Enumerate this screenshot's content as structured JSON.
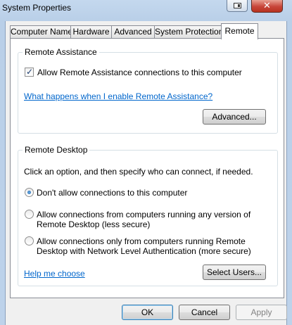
{
  "window": {
    "title": "System Properties",
    "close_label": "✕"
  },
  "tabs": [
    {
      "label": "Computer Name"
    },
    {
      "label": "Hardware"
    },
    {
      "label": "Advanced"
    },
    {
      "label": "System Protection"
    },
    {
      "label": "Remote",
      "active": true
    }
  ],
  "remote_assistance": {
    "group_title": "Remote Assistance",
    "allow_checkbox_label": "Allow Remote Assistance connections to this computer",
    "allow_checked": true,
    "help_link": "What happens when I enable Remote Assistance?",
    "advanced_button": "Advanced..."
  },
  "remote_desktop": {
    "group_title": "Remote Desktop",
    "instruction": "Click an option, and then specify who can connect, if needed.",
    "options": [
      {
        "label_line1": "Don't allow connections to this computer",
        "label_line2": "",
        "selected": true
      },
      {
        "label_line1": "Allow connections from computers running any version of",
        "label_line2": "Remote Desktop (less secure)",
        "selected": false
      },
      {
        "label_line1": "Allow connections only from computers running Remote",
        "label_line2": "Desktop with Network Level Authentication (more secure)",
        "selected": false
      }
    ],
    "help_link": "Help me choose",
    "select_users_button": "Select Users..."
  },
  "footer": {
    "ok": "OK",
    "cancel": "Cancel",
    "apply": "Apply"
  }
}
